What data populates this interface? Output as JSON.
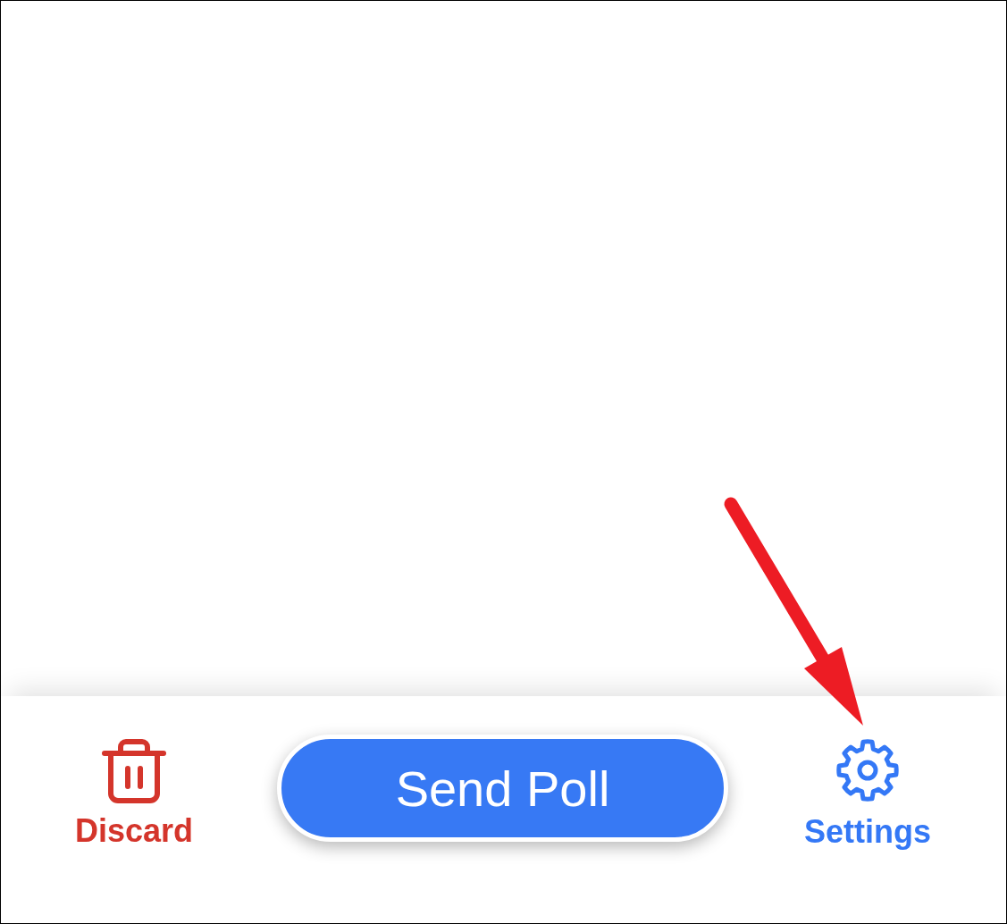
{
  "toolbar": {
    "actions": [
      {
        "kind": "discard",
        "label": "Discard"
      },
      {
        "kind": "send",
        "label": "Send Poll"
      },
      {
        "kind": "settings",
        "label": "Settings"
      }
    ]
  }
}
